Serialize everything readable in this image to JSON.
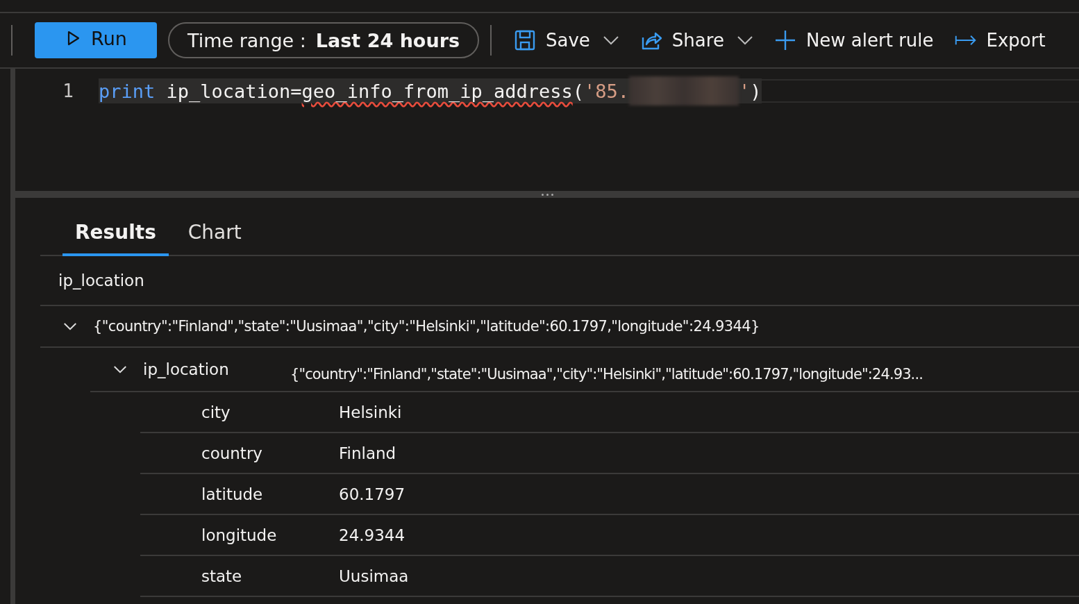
{
  "toolbar": {
    "run": "Run",
    "time_range": {
      "label": "Time range :",
      "value": "Last 24 hours"
    },
    "actions": [
      {
        "kind": "save",
        "label": "Save",
        "dropdown": true
      },
      {
        "kind": "share",
        "label": "Share",
        "dropdown": true
      },
      {
        "kind": "add",
        "label": "New alert rule",
        "dropdown": false
      },
      {
        "kind": "export",
        "label": "Export",
        "dropdown": false
      }
    ]
  },
  "editor": {
    "lines": [
      {
        "number": "1",
        "tokens": [
          {
            "kind": "keyword",
            "text": "print"
          },
          {
            "kind": "plain",
            "text": " ip_location="
          },
          {
            "kind": "error",
            "text": "geo_info_from_ip_address"
          },
          {
            "kind": "plain",
            "text": "("
          },
          {
            "kind": "string",
            "text": "'85."
          },
          {
            "kind": "redacted"
          },
          {
            "kind": "string",
            "text": "'"
          },
          {
            "kind": "plain",
            "text": ")"
          }
        ]
      }
    ]
  },
  "tabs": [
    {
      "label": "Results",
      "selected": true
    },
    {
      "label": "Chart",
      "selected": false
    }
  ],
  "table": {
    "columns": [
      "ip_location"
    ],
    "rows": [
      {
        "expanded": true,
        "value": "{\"country\":\"Finland\",\"state\":\"Uusimaa\",\"city\":\"Helsinki\",\"latitude\":60.1797,\"longitude\":24.9344}",
        "detail": {
          "name": "ip_location",
          "expanded": true,
          "value": "{\"country\":\"Finland\",\"state\":\"Uusimaa\",\"city\":\"Helsinki\",\"latitude\":60.1797,\"longitude\":24.93...",
          "fields": [
            {
              "key": "city",
              "value": "Helsinki"
            },
            {
              "key": "country",
              "value": "Finland"
            },
            {
              "key": "latitude",
              "value": "60.1797"
            },
            {
              "key": "longitude",
              "value": "24.9344"
            },
            {
              "key": "state",
              "value": "Uusimaa"
            }
          ]
        }
      }
    ]
  }
}
